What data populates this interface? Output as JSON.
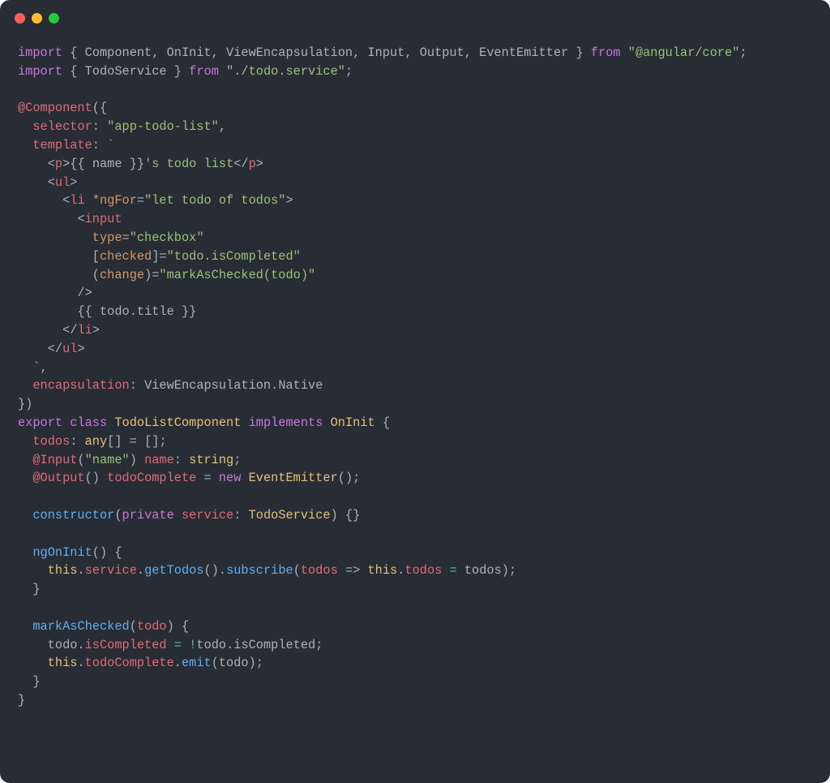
{
  "code": {
    "line1": {
      "import": "import",
      "brace_o": " { ",
      "names": "Component, OnInit, ViewEncapsulation, Input, Output, EventEmitter",
      "brace_c": " } ",
      "from": "from",
      "path": "\"@angular/core\"",
      "semi": ";"
    },
    "line2": {
      "import": "import",
      "brace_o": " { ",
      "names": "TodoService",
      "brace_c": " } ",
      "from": "from",
      "path": "\"./todo.service\"",
      "semi": ";"
    },
    "decorator": "@Component",
    "dec_open": "({",
    "selector_key": "selector",
    "selector_val": "\"app-todo-list\"",
    "template_key": "template",
    "backtick": "`",
    "tpl": {
      "p_open": "<",
      "p": "p",
      "gt": ">",
      "mustache_o": "{{ ",
      "name_var": "name",
      "mustache_c": " }}",
      "p_text": "'s todo list",
      "p_close": "</",
      "ul": "ul",
      "li": "li",
      "ngfor_attr": "*ngFor",
      "ngfor_val": "\"let todo of todos\"",
      "input": "input",
      "type_attr": "type",
      "type_val": "\"checkbox\"",
      "checked_attr": "checked",
      "checked_val": "\"todo.isCompleted\"",
      "change_attr": "change",
      "change_val": "\"markAsChecked(todo)\"",
      "self_close": "/>",
      "title_expr_o": "{{ ",
      "title_obj": "todo",
      "title_dot": ".",
      "title_prop": "title",
      "title_expr_c": " }}"
    },
    "encapsulation_key": "encapsulation",
    "view_enc": "ViewEncapsulation",
    "native": "Native",
    "dec_close": "})",
    "export": "export",
    "class_kw": "class",
    "class_name": "TodoListComponent",
    "implements": "implements",
    "oninit": "OnInit",
    "brace_open": " {",
    "todos_prop": "todos",
    "any": "any",
    "brackets": "[]",
    "eq": " = ",
    "empty_arr": "[]",
    "semi": ";",
    "input_dec": "@Input",
    "input_arg": "\"name\"",
    "name_prop": "name",
    "string_t": "string",
    "output_dec": "@Output",
    "todo_complete": "todoComplete",
    "new_kw": "new",
    "event_emitter": "EventEmitter",
    "parens": "()",
    "constructor": "constructor",
    "private": "private",
    "service": "service",
    "todo_service": "TodoService",
    "empty_body": " {}",
    "ngoninit": "ngOnInit",
    "this": "this",
    "get_todos": "getTodos",
    "subscribe": "subscribe",
    "todos_param": "todos",
    "arrow": " => ",
    "mark_checked": "markAsChecked",
    "todo_param": "todo",
    "is_completed": "isCompleted",
    "bang": "!",
    "emit": "emit",
    "brace_close": "}"
  }
}
